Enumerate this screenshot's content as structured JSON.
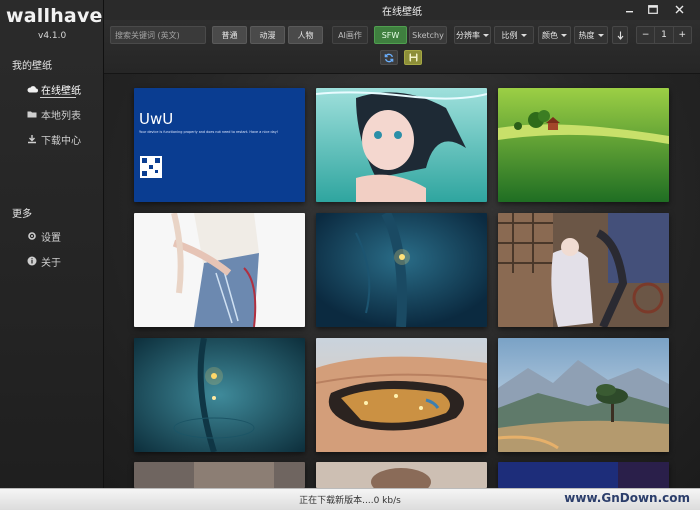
{
  "app": {
    "logo": "wallhaven",
    "version": "v4.1.0",
    "title": "在线壁纸"
  },
  "sidebar": {
    "section_main": "我的壁纸",
    "items": [
      {
        "label": "在线壁纸",
        "icon": "cloud-icon",
        "active": true
      },
      {
        "label": "本地列表",
        "icon": "folder-icon"
      },
      {
        "label": "下载中心",
        "icon": "download-icon"
      }
    ],
    "section_more": "更多",
    "more_items": [
      {
        "label": "设置",
        "icon": "gear-icon"
      },
      {
        "label": "关于",
        "icon": "info-icon"
      }
    ]
  },
  "toolbar": {
    "search_placeholder": "搜索关键词 (英文)",
    "categories": [
      "普通",
      "动漫",
      "人物"
    ],
    "ai_label": "AI画作",
    "purity": {
      "sfw": "SFW",
      "sketchy": "Sketchy"
    },
    "dropdowns": [
      "分辨率",
      "比例",
      "颜色",
      "热度"
    ],
    "page": {
      "minus": "−",
      "value": "1",
      "plus": "+"
    }
  },
  "thumbnails": [
    {
      "name": "uwu-bsod",
      "title": "UwU",
      "text": "Your device is functioning properly and does not need to restart. Have a nice day!"
    },
    {
      "name": "anime-girl-underwater"
    },
    {
      "name": "green-fields-house"
    },
    {
      "name": "girl-white-top"
    },
    {
      "name": "underwater-lantern"
    },
    {
      "name": "anime-girl-window"
    },
    {
      "name": "lantern-in-water"
    },
    {
      "name": "desert-oasis-city"
    },
    {
      "name": "mountain-tree-landscape"
    }
  ],
  "status": {
    "text": "正在下载新版本....0 kb/s"
  },
  "watermark": "www.GnDown.com",
  "colors": {
    "sfw_green": "#3f7f3f",
    "save_yellow": "#8d8f38",
    "bsod_blue": "#0a3d91"
  }
}
